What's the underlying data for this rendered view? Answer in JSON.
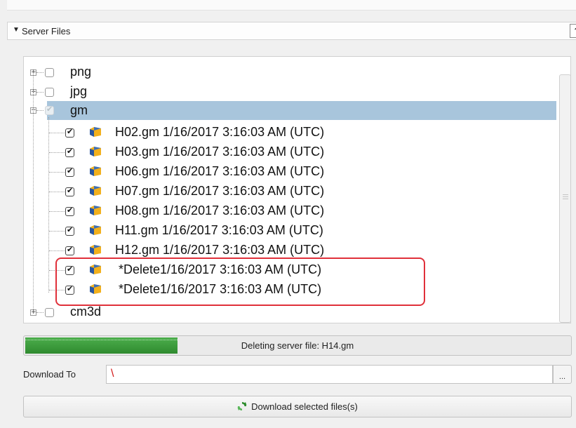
{
  "section": {
    "title": "Server Files",
    "help": "?"
  },
  "tree": {
    "folders_top": [
      "png",
      "jpg",
      "gm"
    ],
    "gm_files": [
      "H02.gm 1/16/2017 3:16:03 AM (UTC)",
      "H03.gm 1/16/2017 3:16:03 AM (UTC)",
      "H06.gm 1/16/2017 3:16:03 AM (UTC)",
      "H07.gm 1/16/2017 3:16:03 AM (UTC)",
      "H08.gm 1/16/2017 3:16:03 AM (UTC)",
      "H11.gm 1/16/2017 3:16:03 AM (UTC)",
      "H12.gm 1/16/2017 3:16:03 AM (UTC)"
    ],
    "deleted_files": [
      " *Delete1/16/2017 3:16:03 AM (UTC)",
      " *Delete1/16/2017 3:16:03 AM (UTC)"
    ],
    "folder_bottom": "cm3d",
    "expander_collapsed": "+",
    "expander_expanded": "−",
    "check_glyph": "✔"
  },
  "progress": {
    "text": "Deleting server file: H14.gm",
    "fraction": 0.28,
    "color": "#3c9a3c"
  },
  "download_to": {
    "label": "Download To",
    "value": "\\",
    "browse": "..."
  },
  "download_button": {
    "label": "Download selected files(s)"
  },
  "colors": {
    "selection": "#a8c5dc",
    "highlight": "#e0303a",
    "path_text": "#d21414"
  }
}
